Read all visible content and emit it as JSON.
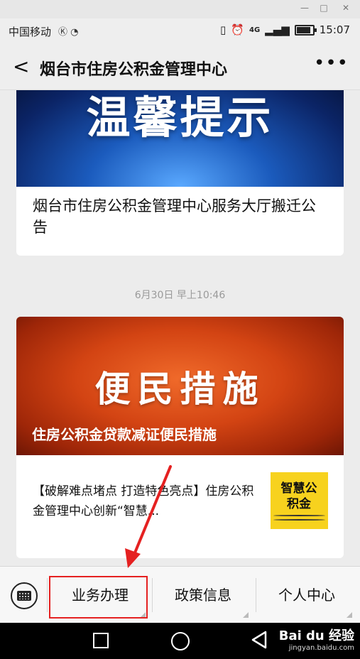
{
  "status_bar": {
    "carrier": "中国移动",
    "carrier_icons": "Ⓚ ◔",
    "signal": "4G",
    "time": "15:07",
    "battery_level": 0.85
  },
  "header": {
    "title": "烟台市住房公积金管理中心"
  },
  "feed": {
    "article1": {
      "banner_text": "温馨提示",
      "title": "烟台市住房公积金管理中心服务大厅搬迁公告"
    },
    "timestamp": "6月30日 早上10:46",
    "article2": {
      "banner_text": "便民措施",
      "banner_subtitle": "住房公积金贷款减证便民措施",
      "item_text": "【破解难点堵点 打造特色亮点】住房公积金管理中心创新“智慧...",
      "thumbnail_text": "智慧公积金"
    }
  },
  "menu_bar": {
    "items": [
      "业务办理",
      "政策信息",
      "个人中心"
    ]
  },
  "watermark": {
    "main": "Bai du 经验",
    "sub": "jingyan.baidu.com"
  },
  "colors": {
    "highlight": "#e52121",
    "annotation_arrow": "#e52121"
  }
}
